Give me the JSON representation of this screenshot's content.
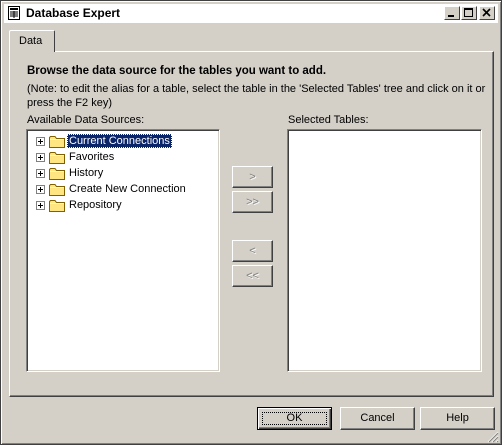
{
  "window": {
    "title": "Database Expert"
  },
  "tabs": [
    {
      "label": "Data",
      "active": true
    }
  ],
  "content": {
    "heading": "Browse the data source for the tables you want to add.",
    "note": "(Note: to edit the alias for a table, select the table in the 'Selected Tables' tree and click on it or press the F2 key)",
    "available_label": "Available Data Sources:",
    "selected_label": "Selected Tables:"
  },
  "available_sources": [
    {
      "label": "Current Connections",
      "icon": "folder-icon",
      "selected": true
    },
    {
      "label": "Favorites",
      "icon": "folder-icon",
      "selected": false
    },
    {
      "label": "History",
      "icon": "folder-icon",
      "selected": false
    },
    {
      "label": "Create New Connection",
      "icon": "folder-icon",
      "selected": false
    },
    {
      "label": "Repository",
      "icon": "folder-icon",
      "selected": false
    }
  ],
  "selected_tables": [],
  "move_buttons": {
    "add": ">",
    "add_all": ">>",
    "remove": "<",
    "remove_all": "<<"
  },
  "footer": {
    "ok": "OK",
    "cancel": "Cancel",
    "help": "Help"
  },
  "colors": {
    "face": "#d4d0c8",
    "selection": "#0a246a",
    "folder": "#ffe680"
  }
}
